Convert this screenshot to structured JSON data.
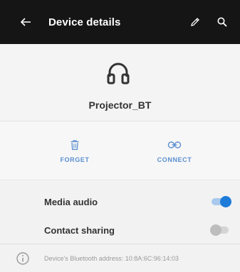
{
  "appbar": {
    "title": "Device details",
    "icons": [
      "back-arrow-icon",
      "pencil-icon",
      "search-icon"
    ]
  },
  "device": {
    "icon": "headphones-icon",
    "name": "Projector_BT"
  },
  "actions": {
    "forget_label": "FORGET",
    "connect_label": "CONNECT"
  },
  "settings": {
    "media_audio": {
      "label": "Media audio",
      "enabled": true
    },
    "contact_sharing": {
      "label": "Contact sharing",
      "enabled": false
    }
  },
  "footer": {
    "icon": "info-icon",
    "text": "Device's Bluetooth address: 10:8A:6C:96:14:03"
  },
  "colors": {
    "appbar_bg": "#151515",
    "accent": "#1e7bd9",
    "action_text": "#5b8fd0"
  }
}
